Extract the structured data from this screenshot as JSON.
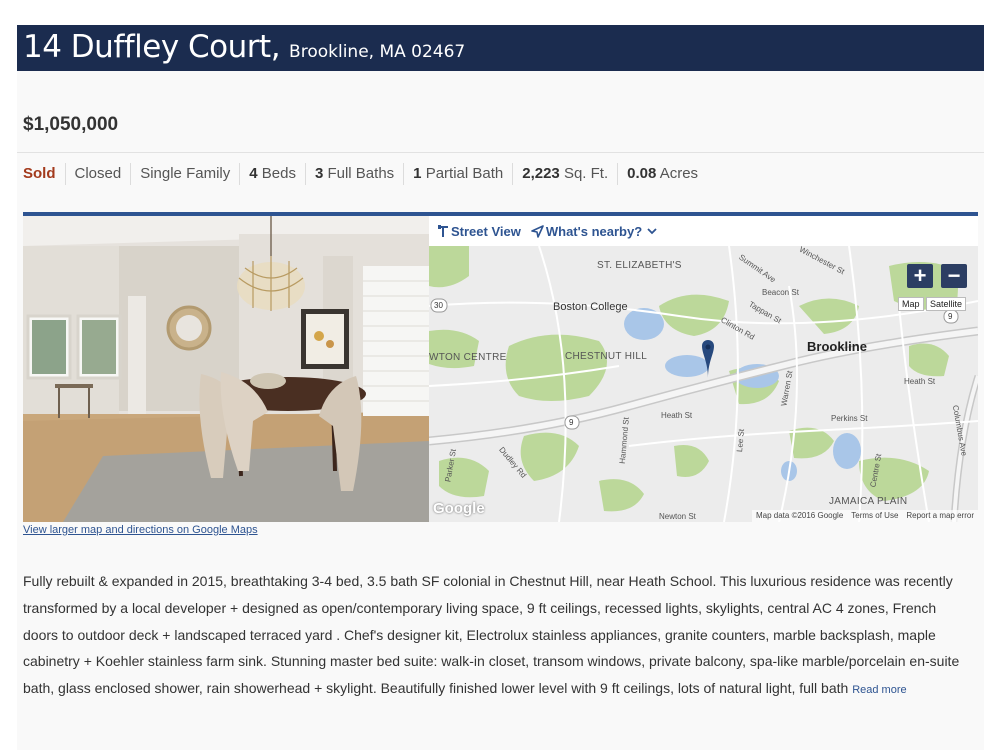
{
  "header": {
    "street": "14 Duffley Court,",
    "city_state_zip": "Brookline, MA 02467"
  },
  "listing": {
    "price": "$1,050,000",
    "facts": {
      "status": "Sold",
      "stage": "Closed",
      "type": "Single Family",
      "beds_num": "4",
      "beds_label": "Beds",
      "full_baths_num": "3",
      "full_baths_label": "Full Baths",
      "partial_baths_num": "1",
      "partial_baths_label": "Partial Bath",
      "sqft_num": "2,223",
      "sqft_label": "Sq. Ft.",
      "acres_num": "0.08",
      "acres_label": "Acres"
    }
  },
  "map_toolbar": {
    "street_view": "Street View",
    "whats_nearby": "What's nearby?"
  },
  "map": {
    "labels": {
      "st_elizabeths": "ST. ELIZABETH'S",
      "boston_college": "Boston College",
      "chestnut_hill": "CHESTNUT HILL",
      "newton_centre": "WTON CENTRE",
      "brookline": "Brookline",
      "jamaica_plain": "JAMAICA PLAIN",
      "summit_ave": "Summit Ave",
      "winchester_st": "Winchester St",
      "beacon_st": "Beacon St",
      "clinton_rd": "Clinton Rd",
      "tappan_st": "Tappan St",
      "heath_st": "Heath St",
      "heath_st_2": "Heath St",
      "hammond_st": "Hammond St",
      "dudley_rd": "Dudley Rd",
      "parker_st": "Parker St",
      "lee_st": "Lee St",
      "warren_st": "Warren St",
      "perkins_st": "Perkins St",
      "centre_st": "Centre St",
      "columbus_ave": "Columbus Ave",
      "newton_st": "Newton St",
      "route_30": "30",
      "route_9a": "9",
      "route_9b": "9"
    },
    "zoom_in": "+",
    "zoom_out": "−",
    "type_map": "Map",
    "type_satellite": "Satellite",
    "google_logo": "Google",
    "footer": {
      "data": "Map data ©2016 Google",
      "terms": "Terms of Use",
      "report": "Report a map error"
    }
  },
  "map_link": "View larger map and directions on Google Maps",
  "description": {
    "text": "Fully rebuilt & expanded in 2015, breathtaking 3-4 bed, 3.5 bath SF colonial in Chestnut Hill, near Heath School. This luxurious residence was recently transformed by a local developer + designed as open/contemporary living space, 9 ft ceilings, recessed lights, skylights, central AC 4 zones, French doors to outdoor deck + landscaped terraced yard . Chef's designer kit, Electrolux stainless appliances, granite counters, marble backsplash, maple cabinetry + Koehler stainless farm sink. Stunning master bed suite: walk-in closet, transom windows, private balcony, spa-like marble/porcelain en-suite bath, glass enclosed shower, rain showerhead + skylight. Beautifully finished lower level with 9 ft ceilings, lots of natural light, full bath",
    "read_more": "Read more"
  },
  "colors": {
    "header_bg": "#1b2c4f",
    "status_sold": "#a33a1c",
    "accent_blue": "#2e5491",
    "map_water": "#a9c6e8",
    "map_park": "#bcd89a"
  },
  "icons": {
    "street_view": "street-view-pin-icon",
    "whats_nearby": "location-arrow-icon",
    "chevron": "chevron-down-icon",
    "map_marker": "map-marker-icon"
  }
}
